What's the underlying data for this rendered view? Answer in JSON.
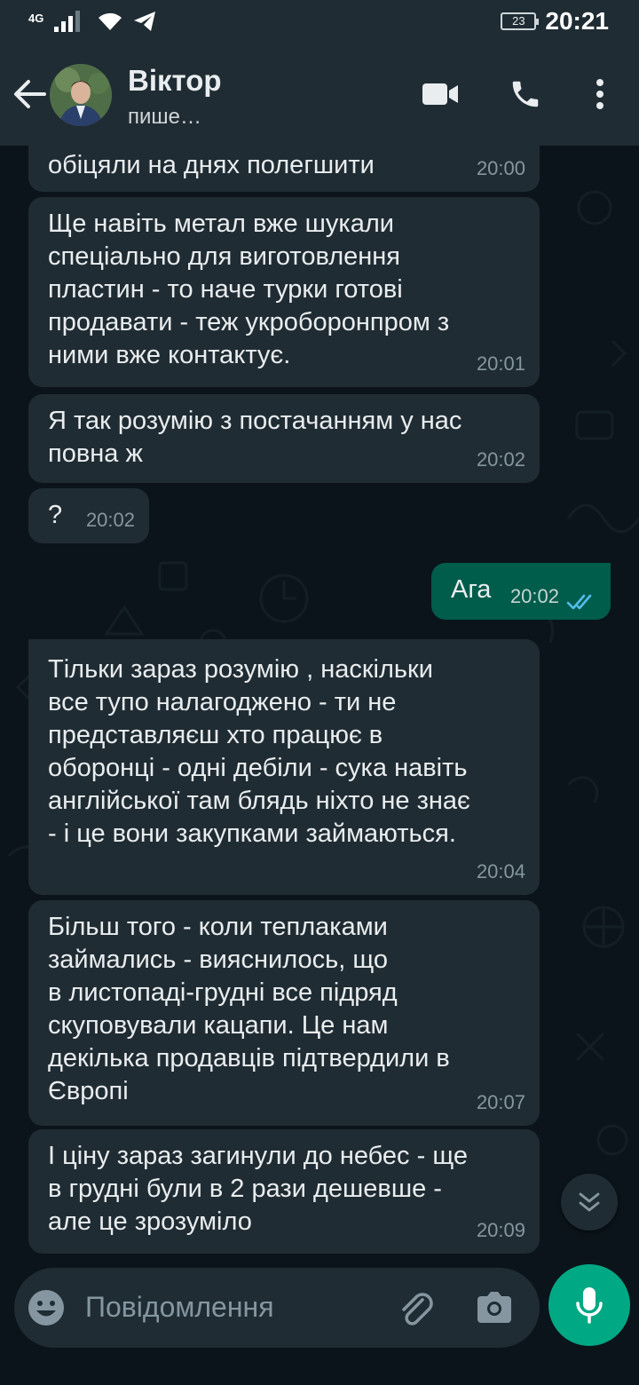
{
  "status_bar": {
    "network": "4G",
    "battery": "23",
    "time": "20:21"
  },
  "header": {
    "contact_name": "Віктор",
    "contact_status": "пише…"
  },
  "messages": [
    {
      "text": "обіцяли на днях полегшити",
      "time": "20:00"
    },
    {
      "text": "Ще навіть метал вже шукали\nспеціально для виготовлення\nпластин - то наче турки готові\nпродавати - теж укроборонпром з\nними вже контактує.",
      "time": "20:01"
    },
    {
      "text": "Я так розумію з постачанням у нас\nповна ж",
      "time": "20:02"
    },
    {
      "text": "?",
      "time": "20:02"
    },
    {
      "text": "Ага",
      "time": "20:02",
      "outgoing": true
    },
    {
      "text": "Тільки зараз розумію , наскільки\nвсе тупо налагоджено - ти не\nпредставляєш хто працює в\nоборонці - одні дебіли - сука навіть\nанглійської там блядь ніхто не знає\n- і це вони закупками займаються.",
      "time": "20:04"
    },
    {
      "text": "Більш того - коли теплаками\nзаймались - вияснилось, що\nв листопаді-грудні все підряд\nскуповували кацапи. Це нам\nдекілька продавців підтвердили в\nЄвропі",
      "time": "20:07"
    },
    {
      "text": "І ціну зараз загинули до небес - ще\nв грудні були в 2 рази дешевше -\nале це зрозуміло",
      "time": "20:09"
    }
  ],
  "input": {
    "placeholder": "Повідомлення"
  }
}
